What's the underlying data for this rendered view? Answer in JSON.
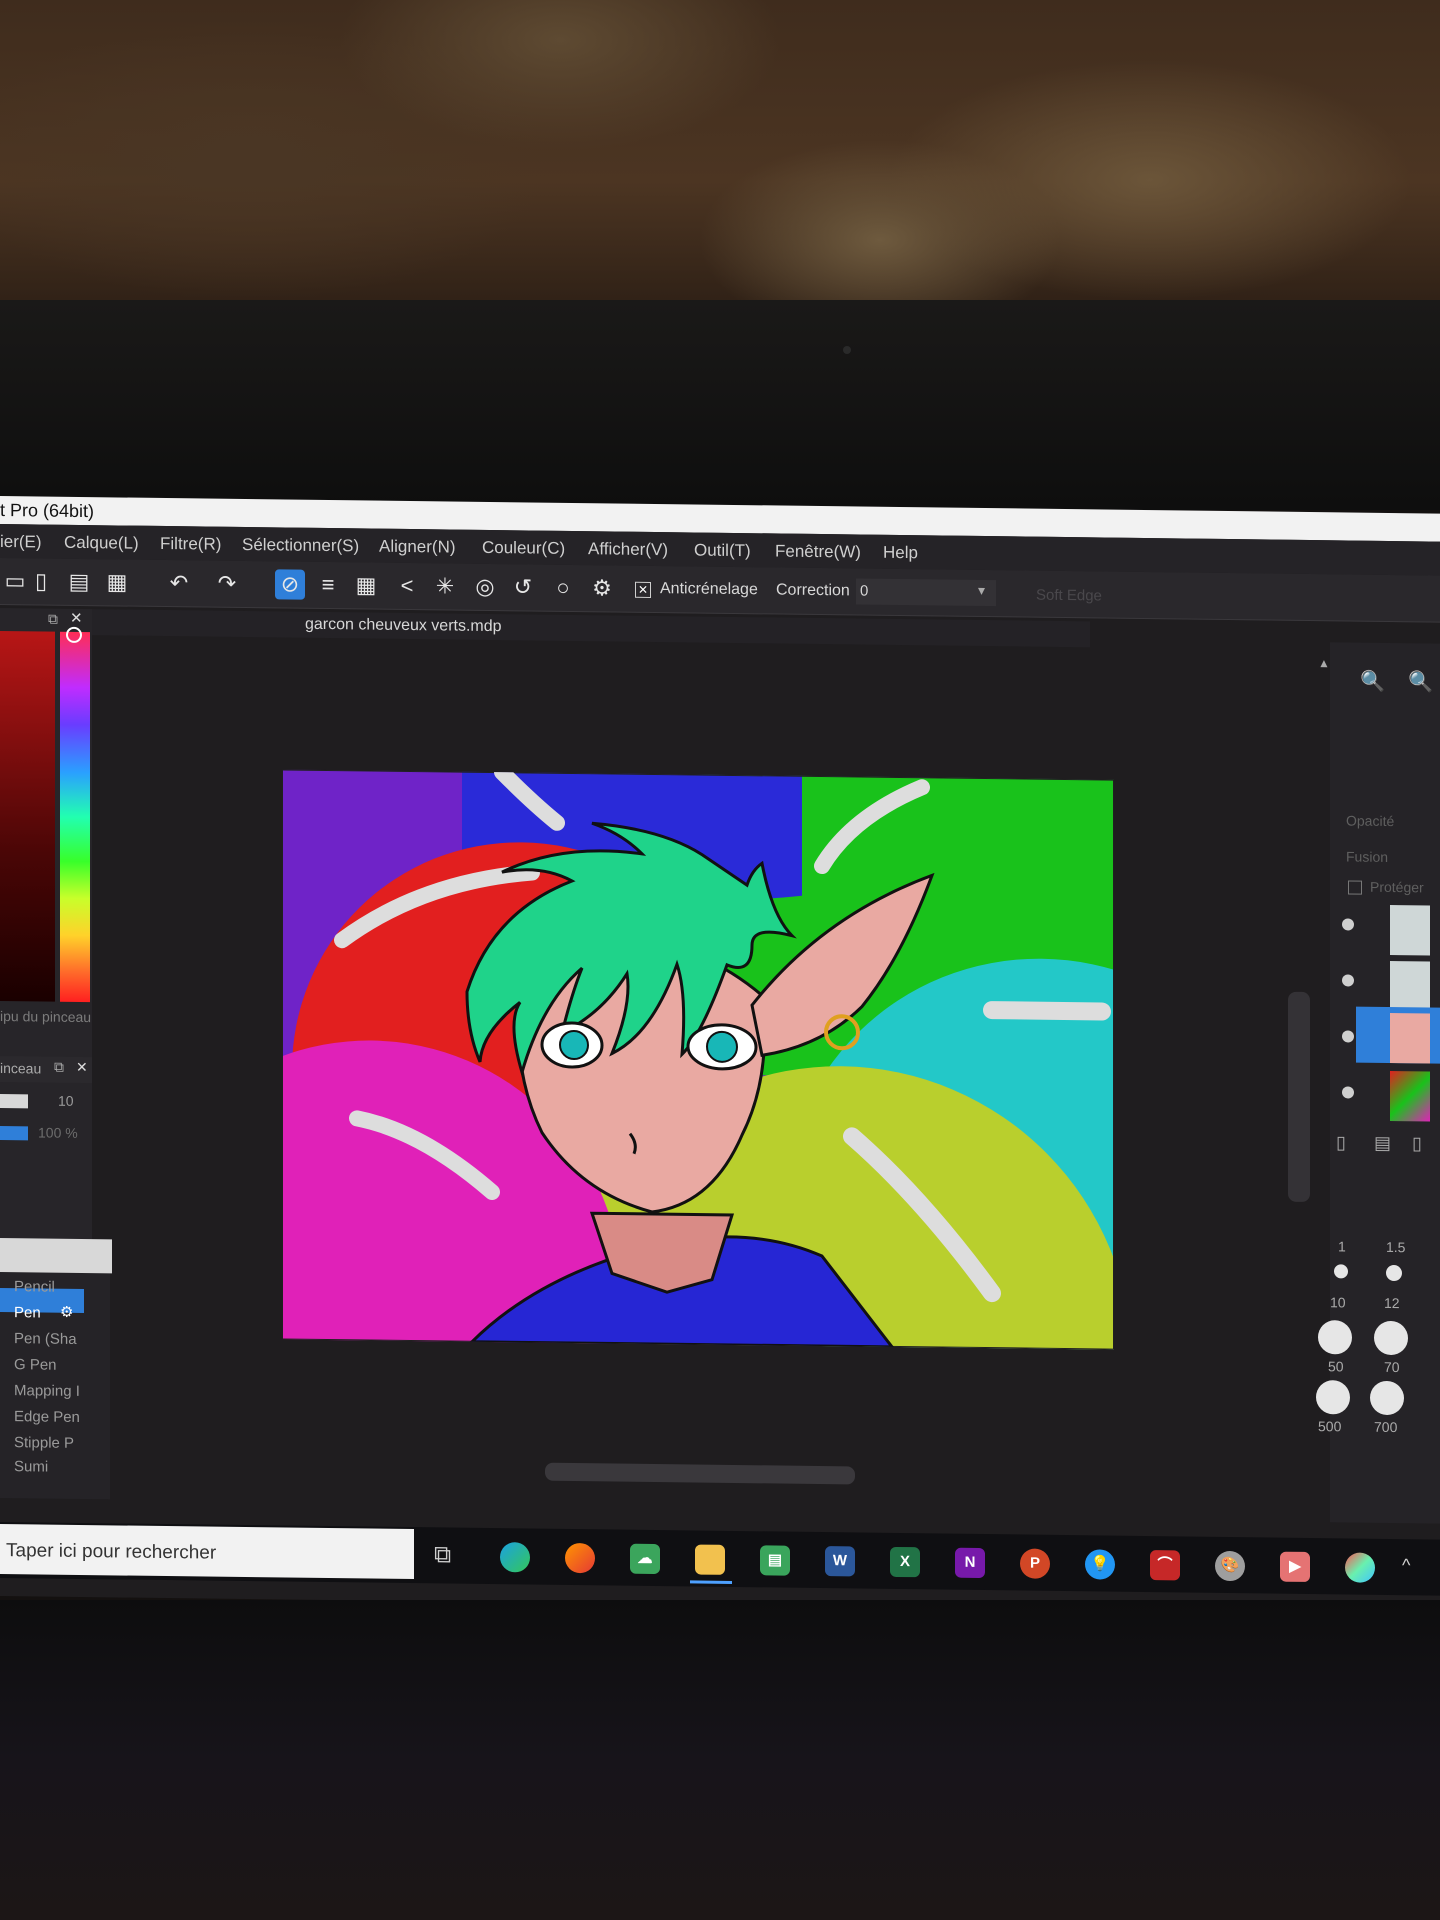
{
  "window": {
    "title": "t Pro (64bit)",
    "tab_name": "garcon cheuveux verts.mdp"
  },
  "menu": [
    "ier(E)",
    "Calque(L)",
    "Filtre(R)",
    "Sélectionner(S)",
    "Aligner(N)",
    "Couleur(C)",
    "Afficher(V)",
    "Outil(T)",
    "Fenêtre(W)",
    "Help"
  ],
  "toolbar": {
    "antialias_label": "Anticrénelage",
    "correction_label": "Correction",
    "correction_value": "0",
    "soft_edge_label": "Soft Edge"
  },
  "left_panel": {
    "brush_label": "ipu du pinceau",
    "brush_panel_title": "inceau",
    "size_value": "10",
    "opacity_value": "100 %",
    "tools": [
      "Pencil",
      "Pen",
      "Pen (Sha",
      "G Pen",
      "Mapping I",
      "Edge Pen",
      "Stipple P",
      "Sumi"
    ],
    "selected_tool": "Pen"
  },
  "right_panel": {
    "opacity_label": "Opacité",
    "fusion_label": "Fusion",
    "protect_label": "Protéger",
    "brush_sizes_row1": [
      "1",
      "1.5"
    ],
    "brush_sizes_row2": [
      "10",
      "12"
    ],
    "brush_sizes_row3": [
      "50",
      "70"
    ],
    "brush_sizes_row4": [
      "500",
      "700"
    ]
  },
  "taskbar": {
    "search_placeholder": "Taper ici pour rechercher",
    "apps": [
      "task-view",
      "edge",
      "firefox",
      "cloud",
      "file-explorer",
      "notes",
      "word",
      "excel",
      "onenote",
      "powerpoint",
      "bulb",
      "acrobat",
      "paint",
      "video",
      "firealpaca"
    ]
  },
  "colors": {
    "accent": "#2f7fd9",
    "hair": "#1fd38a",
    "skin": "#e9a9a2"
  }
}
